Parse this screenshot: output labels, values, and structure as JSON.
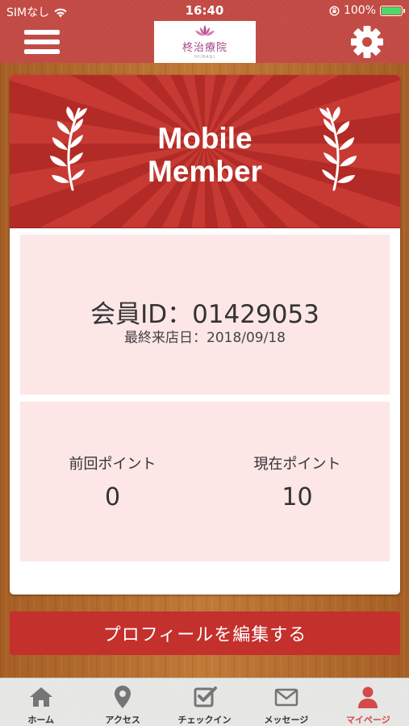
{
  "status_bar": {
    "carrier": "SIMなし",
    "time": "16:40",
    "battery": "100%",
    "battery_level": 1.0
  },
  "header": {
    "logo_text": "柊治療院",
    "logo_sub": "HIIRAGI"
  },
  "card": {
    "banner_title_line1": "Mobile",
    "banner_title_line2": "Member",
    "member_id": "会員ID：01429053",
    "last_visit": "最終来店日：2018/09/18",
    "previous_points_label": "前回ポイント",
    "previous_points": "0",
    "current_points_label": "現在ポイント",
    "current_points": "10"
  },
  "edit_profile_label": "プロフィールを編集する",
  "tabs": [
    {
      "label": "ホーム",
      "icon": "home-icon"
    },
    {
      "label": "アクセス",
      "icon": "location-pin-icon"
    },
    {
      "label": "チェックイン",
      "icon": "checkin-icon"
    },
    {
      "label": "メッセージ",
      "icon": "envelope-icon"
    },
    {
      "label": "マイページ",
      "icon": "person-icon",
      "active": true
    }
  ],
  "colors": {
    "header_red": "#c54a44",
    "banner_red": "#c73a33",
    "panel_pink": "#fce6e6",
    "button_red": "#c4302c",
    "active_tab": "#d24a4a",
    "inactive_icon": "#757575"
  }
}
